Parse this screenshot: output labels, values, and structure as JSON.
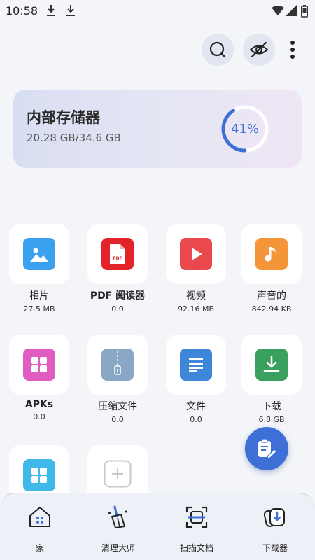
{
  "status_bar": {
    "time": "10:58"
  },
  "storage": {
    "title": "内部存储器",
    "size": "20.28 GB/34.6 GB",
    "percent_label": "41%",
    "percent": 0.41
  },
  "categories": [
    {
      "label": "相片",
      "size": "27.5 MB",
      "icon": "image-icon",
      "color": "#3aa0f0"
    },
    {
      "label": "PDF 阅读器",
      "size": "0.0",
      "icon": "pdf-icon",
      "color": "#e2242a"
    },
    {
      "label": "视频",
      "size": "92.16 MB",
      "icon": "play-icon",
      "color": "#e9484c"
    },
    {
      "label": "声音的",
      "size": "842.94 KB",
      "icon": "music-note-icon",
      "color": "#f5953a"
    },
    {
      "label": "APKs",
      "size": "0.0",
      "icon": "apps-grid-icon",
      "color": "#e05cc0"
    },
    {
      "label": "压缩文件",
      "size": "0.0",
      "icon": "zip-icon",
      "color": "#8aa8c6"
    },
    {
      "label": "文件",
      "size": "0.0",
      "icon": "document-icon",
      "color": "#3d86d8"
    },
    {
      "label": "下载",
      "size": "6.8 GB",
      "icon": "download-icon",
      "color": "#3aa05e"
    },
    {
      "label": "",
      "size": "",
      "icon": "apps-grid-icon",
      "color": "#3fb8ea"
    },
    {
      "label": "",
      "size": "",
      "icon": "add-icon",
      "color": "#c9c9c9"
    }
  ],
  "bottom_nav": {
    "items": [
      {
        "label": "家",
        "icon": "home-icon"
      },
      {
        "label": "清理大师",
        "icon": "broom-icon"
      },
      {
        "label": "扫描文档",
        "icon": "scan-icon"
      },
      {
        "label": "下载器",
        "icon": "downloader-icon"
      }
    ]
  },
  "colors": {
    "accent": "#3d6fd6",
    "background": "#f3f5f9"
  }
}
